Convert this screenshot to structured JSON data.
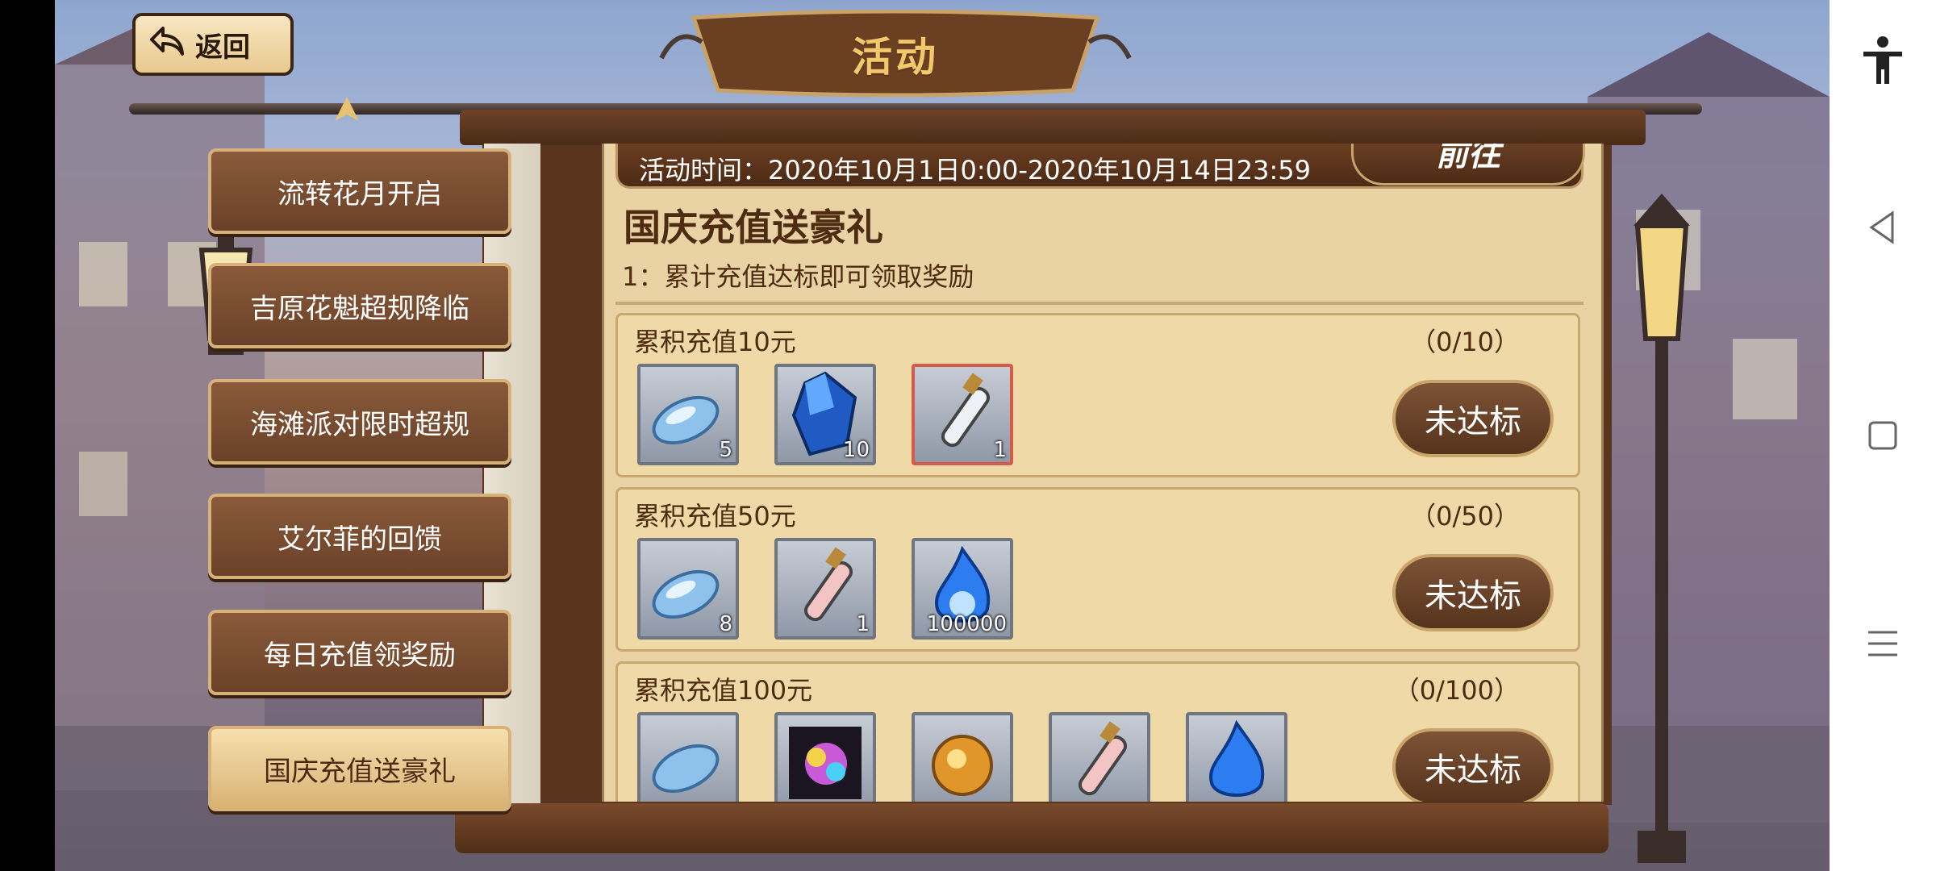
{
  "header": {
    "back_label": "返回",
    "title": "活动"
  },
  "side_tabs": [
    {
      "label": "流转花月开启",
      "active": false
    },
    {
      "label": "吉原花魁超规降临",
      "active": false
    },
    {
      "label": "海滩派对限时超规",
      "active": false
    },
    {
      "label": "艾尔菲的回馈",
      "active": false
    },
    {
      "label": "每日充值领奖励",
      "active": false
    },
    {
      "label": "国庆充值送豪礼",
      "active": true
    }
  ],
  "event": {
    "time": "活动时间：2020年10月1日0:00-2020年10月14日23:59",
    "go_label": "前往",
    "title": "国庆充值送豪礼",
    "description": "1：累计充值达标即可领取奖励",
    "tiers": [
      {
        "label": "累积充值10元",
        "progress": "（0/10）",
        "status": "未达标",
        "items": [
          {
            "icon": "crystal-disc-icon",
            "qty": "5"
          },
          {
            "icon": "blue-gem-icon",
            "qty": "10"
          },
          {
            "icon": "potion-vial-icon",
            "qty": "1"
          }
        ]
      },
      {
        "label": "累积充值50元",
        "progress": "（0/50）",
        "status": "未达标",
        "items": [
          {
            "icon": "crystal-disc-icon",
            "qty": "8"
          },
          {
            "icon": "red-potion-icon",
            "qty": "1"
          },
          {
            "icon": "blue-flame-icon",
            "qty": "100000"
          }
        ]
      },
      {
        "label": "累积充值100元",
        "progress": "（0/100）",
        "status": "未达标",
        "items": [
          {
            "icon": "crystal-disc-icon",
            "qty": ""
          },
          {
            "icon": "rainbow-cube-icon",
            "qty": ""
          },
          {
            "icon": "gold-orb-icon",
            "qty": ""
          },
          {
            "icon": "red-potion-icon",
            "qty": ""
          },
          {
            "icon": "blue-flame-icon",
            "qty": ""
          }
        ]
      }
    ]
  },
  "colors": {
    "accent_gold": "#f2c86d",
    "wood": "#5a341d",
    "parchment": "#e9d3a4"
  }
}
